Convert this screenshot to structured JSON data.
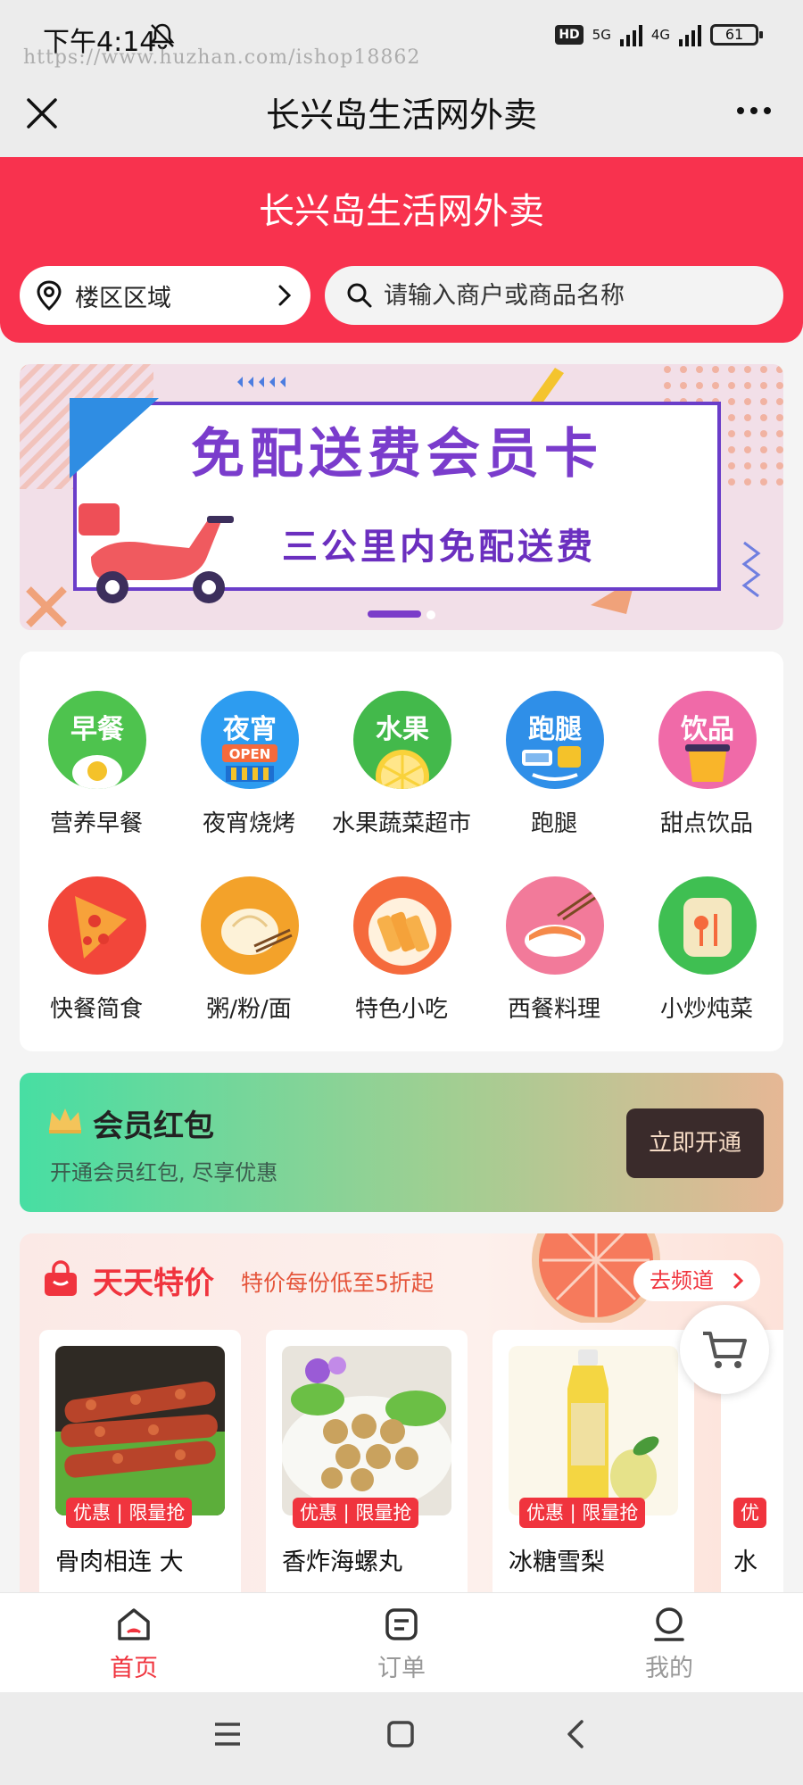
{
  "status_bar": {
    "time": "下午4:14",
    "hd": "HD",
    "net1": "5G",
    "net2": "4G",
    "battery": "61",
    "watermark": "https://www.huzhan.com/ishop18862"
  },
  "title_bar": {
    "title": "长兴岛生活网外卖"
  },
  "header": {
    "title": "长兴岛生活网外卖",
    "area_label": "楼区区域",
    "search_placeholder": "请输入商户或商品名称"
  },
  "banner": {
    "title": "免配送费会员卡",
    "subtitle": "三公里内免配送费"
  },
  "categories": [
    {
      "label": "营养早餐",
      "icon_text": "早餐",
      "color": "#4ec34e"
    },
    {
      "label": "夜宵烧烤",
      "icon_text": "夜宵",
      "color": "#2d9cf0"
    },
    {
      "label": "水果蔬菜超市",
      "icon_text": "水果",
      "color": "#43b94b"
    },
    {
      "label": "跑腿",
      "icon_text": "跑腿",
      "color": "#2f8fe8"
    },
    {
      "label": "甜点饮品",
      "icon_text": "饮品",
      "color": "#f06aa8"
    },
    {
      "label": "快餐简食",
      "icon_text": "",
      "color": "#f2463a"
    },
    {
      "label": "粥/粉/面",
      "icon_text": "",
      "color": "#f3a22a"
    },
    {
      "label": "特色小吃",
      "icon_text": "",
      "color": "#f56a3c"
    },
    {
      "label": "西餐料理",
      "icon_text": "",
      "color": "#f27a9a"
    },
    {
      "label": "小炒炖菜",
      "icon_text": "",
      "color": "#3fbf52"
    }
  ],
  "member": {
    "title": "会员红包",
    "subtitle": "开通会员红包, 尽享优惠",
    "button": "立即开通"
  },
  "special": {
    "title": "天天特价",
    "subtitle": "特价每份低至5折起",
    "channel_button": "去频道",
    "products": [
      {
        "name": "骨肉相连 大",
        "tag": "优惠 | 限量抢"
      },
      {
        "name": "香炸海螺丸",
        "tag": "优惠 | 限量抢"
      },
      {
        "name": "冰糖雪梨",
        "tag": "优惠 | 限量抢"
      },
      {
        "name": "水",
        "tag": "优"
      }
    ]
  },
  "bottom_nav": {
    "items": [
      {
        "label": "首页",
        "active": true
      },
      {
        "label": "订单",
        "active": false
      },
      {
        "label": "我的",
        "active": false
      }
    ]
  },
  "colors": {
    "brand_red": "#f8324e",
    "accent_red": "#f0343e",
    "banner_purple": "#7a3ccc"
  }
}
